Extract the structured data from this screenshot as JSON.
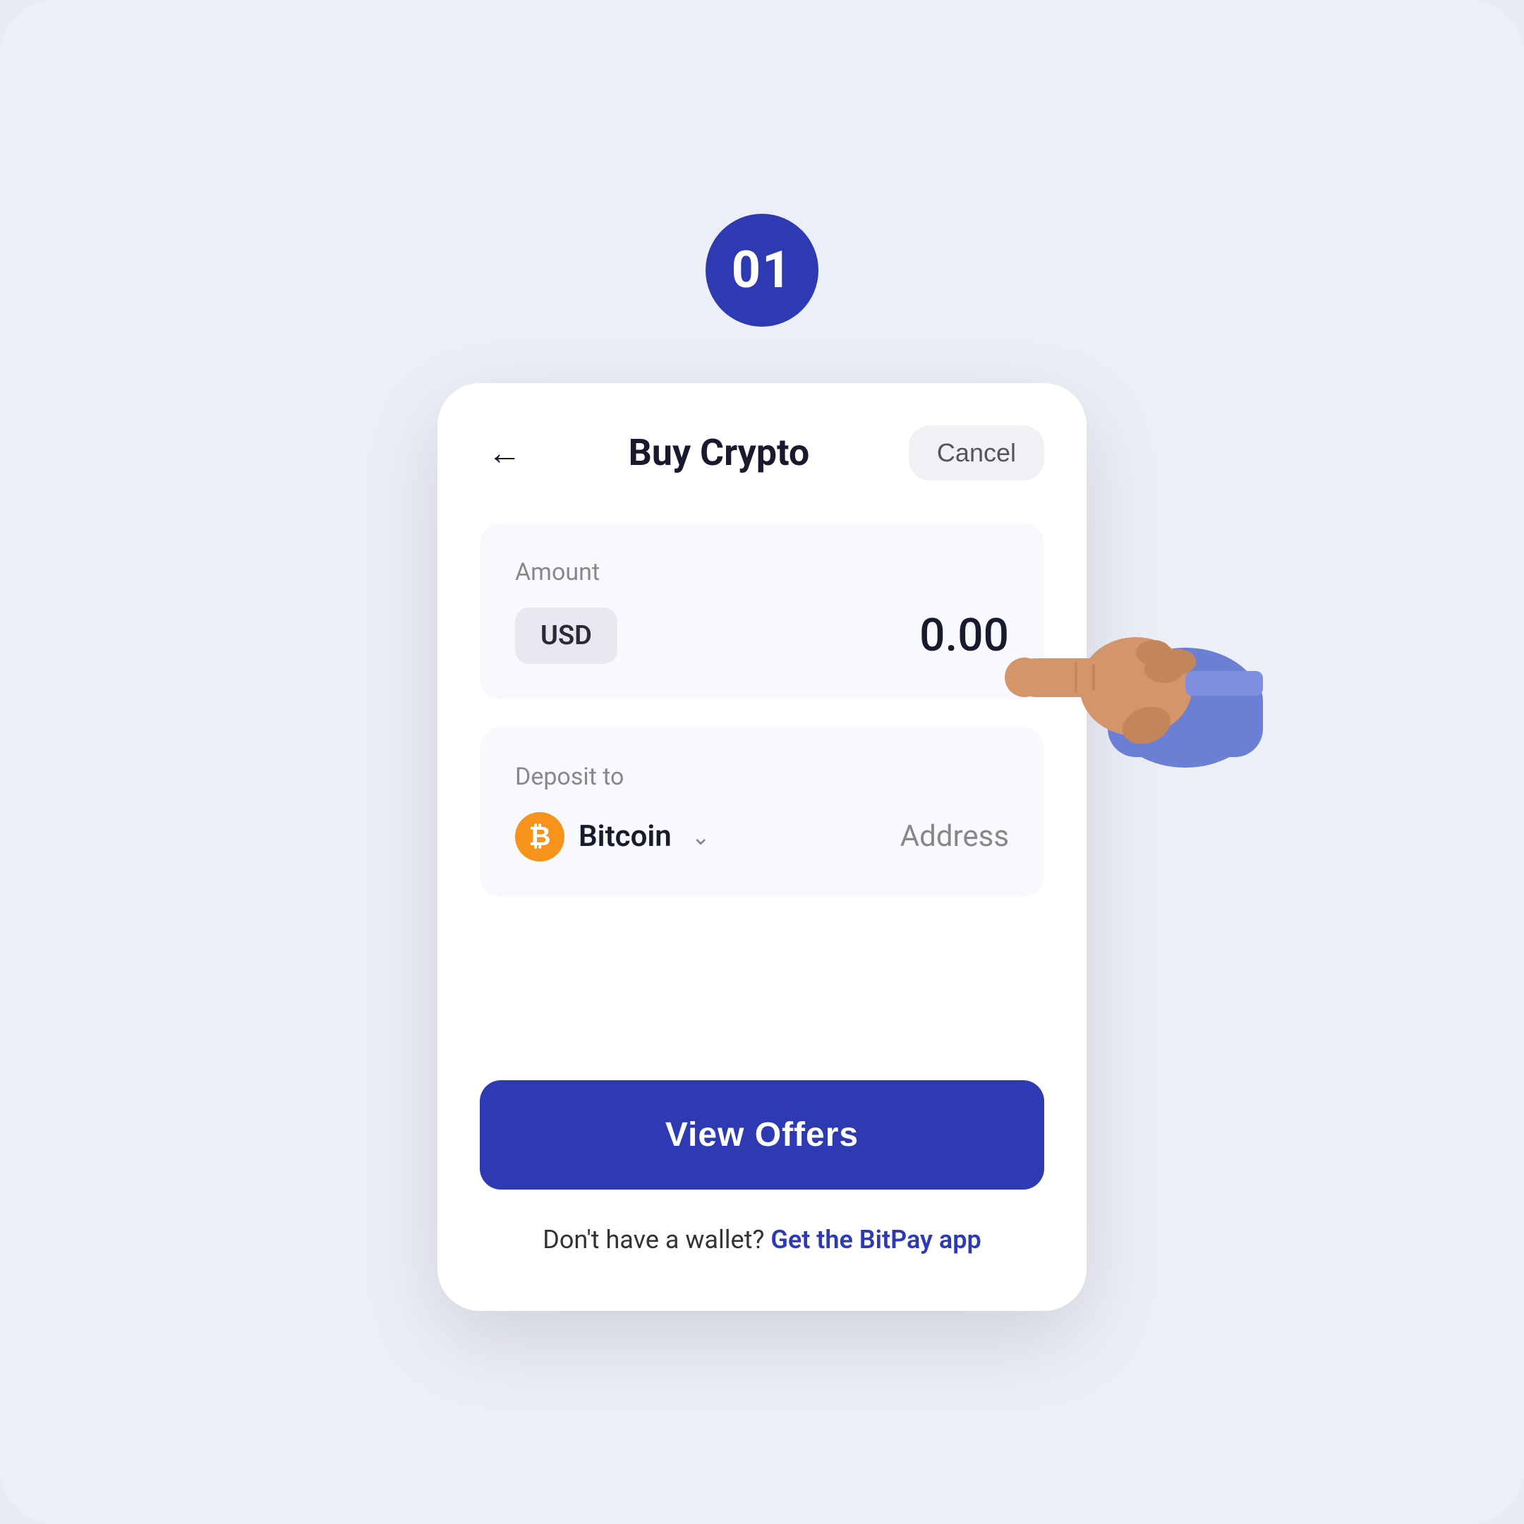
{
  "page": {
    "background_color": "#eceef8",
    "step_number": "01",
    "step_badge_color": "#2d3ab1"
  },
  "header": {
    "title": "Buy Crypto",
    "cancel_label": "Cancel",
    "back_icon": "←"
  },
  "amount_section": {
    "label": "Amount",
    "currency": "USD",
    "value": "0.00"
  },
  "deposit_section": {
    "label": "Deposit to",
    "crypto_name": "Bitcoin",
    "address_placeholder": "Address",
    "chevron": "⌄"
  },
  "actions": {
    "view_offers_label": "View Offers",
    "bottom_text_static": "Don't have a wallet?",
    "bottom_link_label": "Get the BitPay app"
  }
}
